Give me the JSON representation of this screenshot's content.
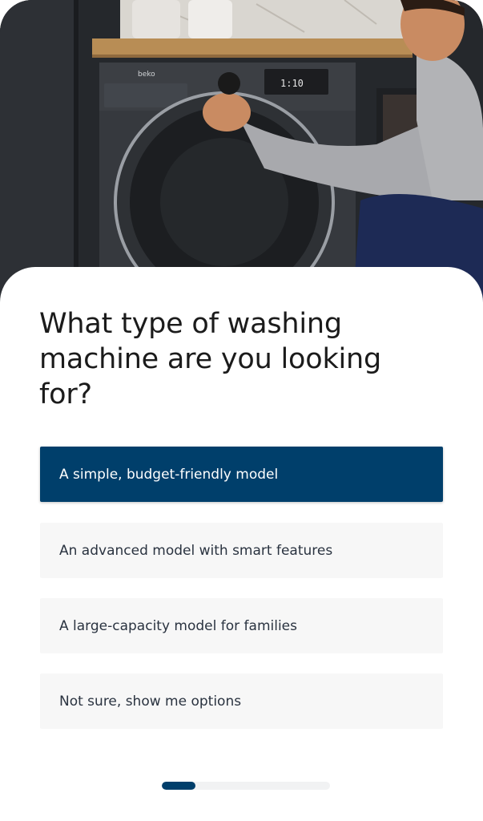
{
  "hero": {
    "image": "washing-machine-photo",
    "brand_mark": "beko",
    "display_readout": "1:10"
  },
  "question": {
    "title": "What type of washing machine are you looking for?"
  },
  "options": [
    {
      "label": "A simple, budget-friendly model",
      "selected": true
    },
    {
      "label": "An advanced model with smart features",
      "selected": false
    },
    {
      "label": "A large-capacity model for families",
      "selected": false
    },
    {
      "label": "Not sure, show me options",
      "selected": false
    }
  ],
  "progress": {
    "fraction": 0.2
  },
  "colors": {
    "accent": "#003f6b",
    "option_bg": "#f7f7f7",
    "text": "#1b1b1b"
  }
}
